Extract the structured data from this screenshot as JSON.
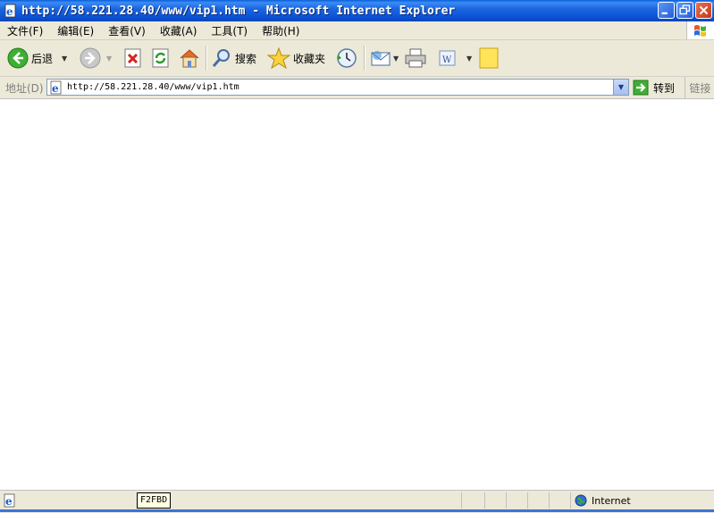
{
  "window": {
    "title": "http://58.221.28.40/www/vip1.htm - Microsoft Internet Explorer"
  },
  "menu": {
    "items": [
      "文件(F)",
      "编辑(E)",
      "查看(V)",
      "收藏(A)",
      "工具(T)",
      "帮助(H)"
    ]
  },
  "toolbar": {
    "back_label": "后退",
    "search_label": "搜索",
    "favorites_label": "收藏夹"
  },
  "address": {
    "label": "地址(D)",
    "url": "http://58.221.28.40/www/vip1.htm",
    "go_label": "转到",
    "links_label": "链接"
  },
  "status": {
    "tooltip": "F2FBD",
    "zone": "Internet"
  },
  "colors": {
    "titlebar": "#0a52d4",
    "chrome": "#ece9d8"
  }
}
